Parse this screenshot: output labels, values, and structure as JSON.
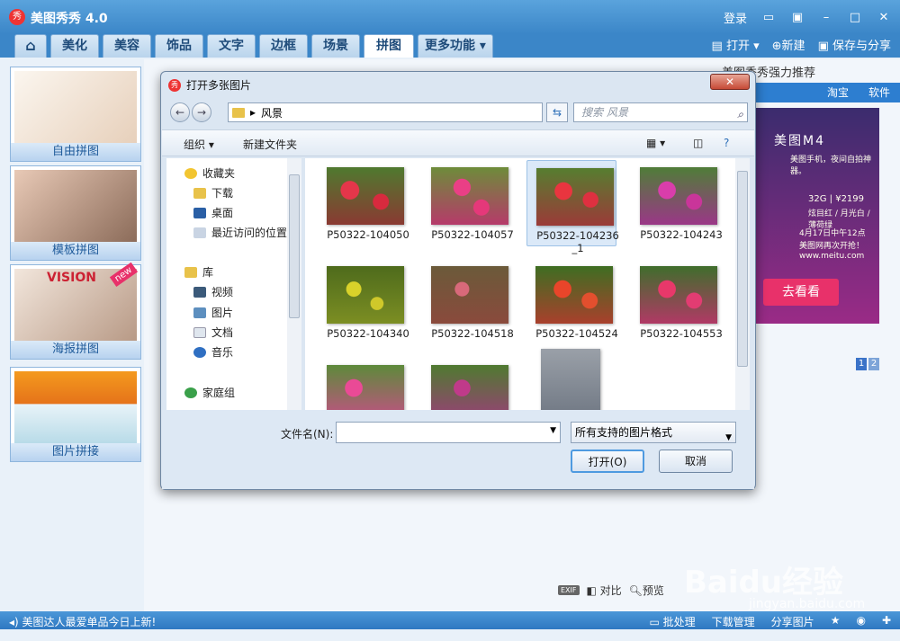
{
  "app": {
    "title": "美图秀秀 4.0",
    "logo": "秀"
  },
  "titlebar": {
    "login": "登录",
    "icons": [
      "chat-icon",
      "skin-icon",
      "minimize-icon",
      "maximize-icon",
      "close-icon"
    ]
  },
  "tabs": [
    {
      "label": "美化"
    },
    {
      "label": "美容"
    },
    {
      "label": "饰品"
    },
    {
      "label": "文字"
    },
    {
      "label": "边框"
    },
    {
      "label": "场景"
    },
    {
      "label": "拼图",
      "active": true
    },
    {
      "label": "更多功能 ▾"
    }
  ],
  "toolbar": {
    "open": "打开",
    "new": "新建",
    "save": "保存与分享"
  },
  "left_cards": [
    {
      "label": "自由拼图"
    },
    {
      "label": "模板拼图"
    },
    {
      "label": "海报拼图"
    },
    {
      "label": "图片拼接"
    }
  ],
  "poster_card": {
    "vision": "VISION",
    "badge": "new"
  },
  "right_panel": {
    "title": "美图秀秀强力推荐",
    "tabs": [
      "淘宝",
      "软件"
    ],
    "ad": {
      "brand": "美图M4",
      "line1": "美图手机，夜间自拍神器。",
      "line2": "32G | ¥2199",
      "line3": "炫目红 / 月光白 / 薄荷绿",
      "line4": "4月17日中午12点",
      "line5": "美图网再次开抢！",
      "line6": "www.meitu.com",
      "button": "去看看",
      "pages": [
        "1",
        "2"
      ]
    }
  },
  "dialog": {
    "title": "打开多张图片",
    "logo": "秀",
    "close": "✕",
    "path": "风景",
    "search_placeholder": "搜索 风景",
    "cmd": {
      "organize": "组织 ▾",
      "new_folder": "新建文件夹"
    },
    "nav": [
      {
        "label": "收藏夹",
        "kind": "favorites",
        "icon": "star-icon"
      },
      {
        "label": "下载",
        "kind": "downloads",
        "icon": "folder-icon"
      },
      {
        "label": "桌面",
        "kind": "desktop",
        "icon": "desktop-icon"
      },
      {
        "label": "最近访问的位置",
        "kind": "recent",
        "icon": "recent-icon"
      },
      {
        "label": "库",
        "kind": "library",
        "icon": "library-icon"
      },
      {
        "label": "视频",
        "kind": "videos",
        "icon": "video-icon"
      },
      {
        "label": "图片",
        "kind": "pictures",
        "icon": "picture-icon"
      },
      {
        "label": "文档",
        "kind": "documents",
        "icon": "document-icon"
      },
      {
        "label": "音乐",
        "kind": "music",
        "icon": "music-icon"
      },
      {
        "label": "家庭组",
        "kind": "homegroup",
        "icon": "homegroup-icon"
      }
    ],
    "files": [
      {
        "name": "P50322-104050",
        "color": "#b43b3b"
      },
      {
        "name": "P50322-104057",
        "color": "#c43b66"
      },
      {
        "name": "P50322-104236\n_1",
        "color": "#a93c3c",
        "selected": true
      },
      {
        "name": "P50322-104243",
        "color": "#b43990"
      },
      {
        "name": "P50322-104340",
        "color": "#8a9c22"
      },
      {
        "name": "P50322-104518",
        "color": "#8a4a3c"
      },
      {
        "name": "P50322-104524",
        "color": "#c4502a"
      },
      {
        "name": "P50322-104553",
        "color": "#c13a6b"
      },
      {
        "name": "",
        "color": "#c84e88"
      },
      {
        "name": "",
        "color": "#9c3d7a"
      },
      {
        "name": "",
        "color": "#7a7f8c"
      }
    ],
    "filename_label": "文件名(N):",
    "filename_value": "",
    "filter": "所有支持的图片格式",
    "open_button": "打开(O)",
    "cancel_button": "取消"
  },
  "bottom": {
    "exif": "EXIF",
    "compare": "对比",
    "preview": "预览"
  },
  "statusbar": {
    "left": "美图达人最爱单品今日上新!",
    "batch": "批处理",
    "download": "下载管理",
    "share": "分享图片"
  },
  "watermark": {
    "main": "Baidu经验",
    "sub": "jingyan.baidu.com"
  }
}
